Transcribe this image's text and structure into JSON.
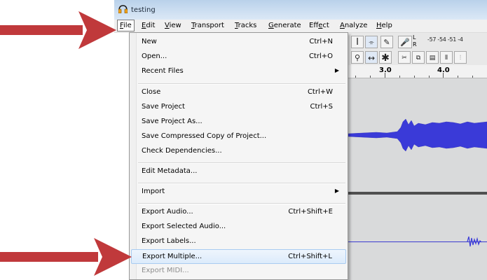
{
  "window": {
    "title": "testing"
  },
  "menubar": {
    "items": [
      {
        "label": "File",
        "mnemonic": "F",
        "rest": "ile"
      },
      {
        "label": "Edit",
        "mnemonic": "E",
        "rest": "dit"
      },
      {
        "label": "View",
        "mnemonic": "V",
        "rest": "iew"
      },
      {
        "label": "Transport",
        "mnemonic": "T",
        "rest": "ransport"
      },
      {
        "label": "Tracks",
        "mnemonic": "T",
        "rest": "racks"
      },
      {
        "label": "Generate",
        "mnemonic": "G",
        "rest": "enerate"
      },
      {
        "label": "Effect",
        "pre": "Eff",
        "mnemonic": "e",
        "rest": "ct"
      },
      {
        "label": "Analyze",
        "mnemonic": "A",
        "rest": "nalyze"
      },
      {
        "label": "Help",
        "mnemonic": "H",
        "rest": "elp"
      }
    ]
  },
  "file_menu": {
    "items": [
      {
        "label": "New",
        "shortcut": "Ctrl+N"
      },
      {
        "label": "Open...",
        "shortcut": "Ctrl+O"
      },
      {
        "label": "Recent Files",
        "shortcut": "",
        "submenu": true
      },
      {
        "label": "Close",
        "shortcut": "Ctrl+W"
      },
      {
        "label": "Save Project",
        "shortcut": "Ctrl+S"
      },
      {
        "label": "Save Project As...",
        "shortcut": ""
      },
      {
        "label": "Save Compressed Copy of Project...",
        "shortcut": ""
      },
      {
        "label": "Check Dependencies...",
        "shortcut": ""
      },
      {
        "label": "Edit Metadata...",
        "shortcut": ""
      },
      {
        "label": "Import",
        "shortcut": "",
        "submenu": true
      },
      {
        "label": "Export Audio...",
        "shortcut": "Ctrl+Shift+E"
      },
      {
        "label": "Export Selected Audio...",
        "shortcut": ""
      },
      {
        "label": "Export Labels...",
        "shortcut": ""
      },
      {
        "label": "Export Multiple...",
        "shortcut": "Ctrl+Shift+L",
        "highlighted": true
      },
      {
        "label": "Export MIDI...",
        "shortcut": "",
        "disabled": true
      }
    ]
  },
  "toolbar": {
    "meter_scale": "-57 -54 -51 -4",
    "meter_l": "L",
    "meter_r": "R"
  },
  "ruler": {
    "labels": [
      "3.0",
      "4.0"
    ]
  },
  "colors": {
    "arrow": "#c0393b",
    "waveform": "#3a3ad8",
    "highlight": "#dcebfb"
  },
  "icons": {
    "app": "headphones-icon",
    "arrow_top": "red-arrow-icon",
    "arrow_bottom": "red-arrow-icon"
  }
}
